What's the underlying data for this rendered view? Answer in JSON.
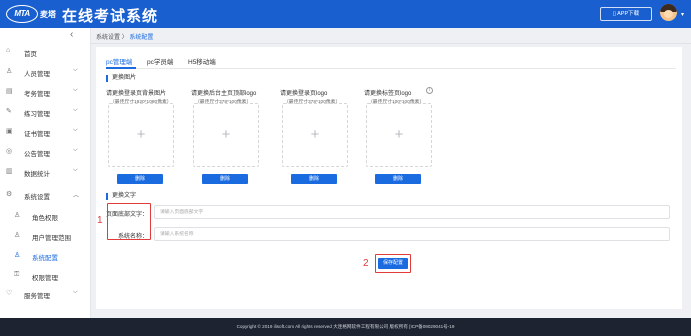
{
  "header": {
    "logo_text": "MTA",
    "logo_cn": "麦塔",
    "title": "在线考试系统",
    "app_button": "APP下载"
  },
  "sidebar": {
    "items": [
      {
        "icon": "home-icon",
        "label": "首页",
        "expanded": false,
        "has_chevron": false
      },
      {
        "icon": "user-icon",
        "label": "人员管理",
        "has_chevron": true
      },
      {
        "icon": "exam-icon",
        "label": "考务管理",
        "has_chevron": true
      },
      {
        "icon": "practice-icon",
        "label": "练习管理",
        "has_chevron": true
      },
      {
        "icon": "certificate-icon",
        "label": "证书管理",
        "has_chevron": true
      },
      {
        "icon": "notice-icon",
        "label": "公告管理",
        "has_chevron": true
      },
      {
        "icon": "stats-icon",
        "label": "数据统计",
        "has_chevron": true
      },
      {
        "icon": "settings-icon",
        "label": "系统设置",
        "has_chevron": true
      },
      {
        "icon": "role-icon",
        "label": "角色权限",
        "sub": true
      },
      {
        "icon": "scope-icon",
        "label": "用户管理范围",
        "sub": true
      },
      {
        "icon": "config-icon",
        "label": "系统配置",
        "sub": true,
        "active": true
      },
      {
        "icon": "permission-icon",
        "label": "权限管理",
        "sub": true
      },
      {
        "icon": "service-icon",
        "label": "服务管理",
        "has_chevron": true
      }
    ]
  },
  "breadcrumb": {
    "parent": "系统设置",
    "separator": "〉",
    "current": "系统配置"
  },
  "tabs": [
    {
      "label": "pc管理端",
      "active": true
    },
    {
      "label": "pc学员端",
      "active": false
    },
    {
      "label": "H5移动端",
      "active": false
    }
  ],
  "images_section": {
    "title": "更换图片",
    "uploads": [
      {
        "title": "请更换登录页背景图片",
        "hint": "（最佳尺寸1920*1080像素）",
        "delete": "删除"
      },
      {
        "title": "请更换后台主页顶部logo",
        "hint": "（最佳尺寸378*100像素）",
        "delete": "删除"
      },
      {
        "title": "请更换登录页logo",
        "hint": "（最佳尺寸378*100像素）",
        "delete": "删除"
      },
      {
        "title": "请更换标签页logo",
        "hint": "（最佳尺寸100*100像素）",
        "delete": "删除"
      }
    ]
  },
  "text_section": {
    "title": "更换文字",
    "footer_text_label": "页面底部文字：",
    "footer_text_placeholder": "请输入页面底部文字",
    "system_name_label": "系统名称：",
    "system_name_placeholder": "请输入系统名称"
  },
  "annotations": {
    "marker_1": "1",
    "marker_2": "2",
    "color": "#e23b3b"
  },
  "save_button": "保存配置",
  "footer": {
    "copyright": "Copyright © 2019 ilisoft.com All rights reserved 大连格网软件工程有限公司 版权所有 [ICP备09029041号-19"
  },
  "colors": {
    "primary": "#1a6ae0",
    "header": "#1a5fd0",
    "footer": "#1d2330"
  }
}
